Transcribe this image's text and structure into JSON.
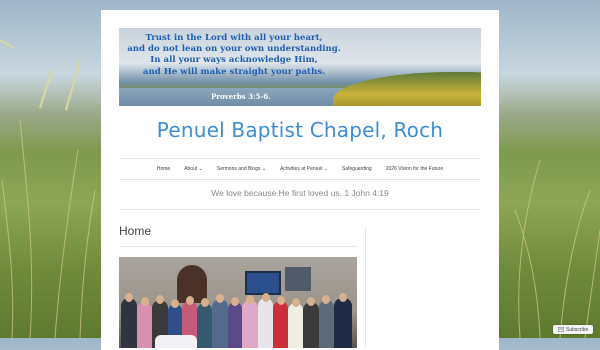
{
  "banner": {
    "verse_lines": [
      "Trust in the Lord with all your heart,",
      "and do not lean on your own understanding.",
      "In all your ways acknowledge Him,",
      "and He will make straight your paths."
    ],
    "reference": "Proverbs 3:5-6."
  },
  "site": {
    "title": "Penuel Baptist Chapel, Roch",
    "tagline": "We love because He first loved us. 1 John 4:19"
  },
  "nav": {
    "items": [
      {
        "label": "Home"
      },
      {
        "label": "About",
        "has_dropdown": true
      },
      {
        "label": "Sermons and Blogs",
        "has_dropdown": true
      },
      {
        "label": "Activities at Penuel",
        "has_dropdown": true
      },
      {
        "label": "Safeguarding"
      },
      {
        "label": "2026 Vision for the Future"
      }
    ],
    "dropdown_glyph": "⌄"
  },
  "page": {
    "heading": "Home"
  },
  "subscribe": {
    "label": "Subscribe"
  },
  "colors": {
    "title": "#3d8ed2",
    "verse": "#1f5fb3"
  }
}
